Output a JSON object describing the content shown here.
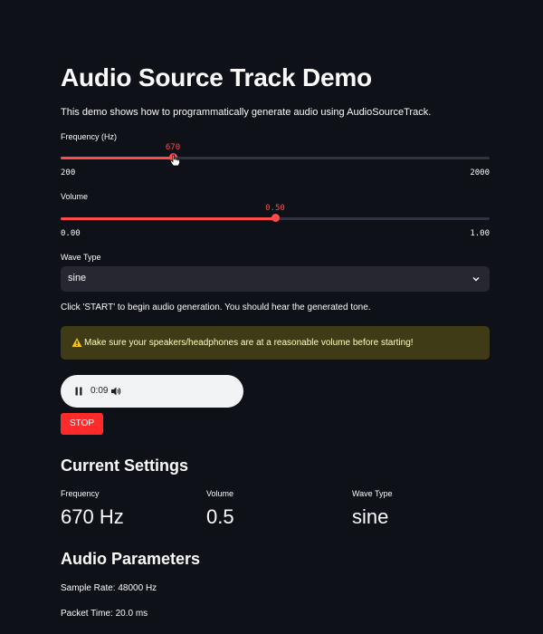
{
  "page": {
    "title": "Audio Source Track Demo",
    "description": "This demo shows how to programmatically generate audio using AudioSourceTrack."
  },
  "frequency_slider": {
    "label": "Frequency (Hz)",
    "value": "670",
    "min": "200",
    "max": "2000",
    "fraction": 0.261
  },
  "volume_slider": {
    "label": "Volume",
    "value": "0.50",
    "min": "0.00",
    "max": "1.00",
    "fraction": 0.5
  },
  "wave_select": {
    "label": "Wave Type",
    "value": "sine",
    "icon": "chevron-down-icon"
  },
  "instructions": "Click 'START' to begin audio generation. You should hear the generated tone.",
  "warning": {
    "icon": "warning-icon",
    "text": "Make sure your speakers/headphones are at a reasonable volume before starting!"
  },
  "player": {
    "time": "0:09",
    "pause_icon": "pause-icon",
    "volume_icon": "volume-icon"
  },
  "stop_button": {
    "label": "STOP"
  },
  "current_settings": {
    "heading": "Current Settings",
    "metrics": [
      {
        "label": "Frequency",
        "value": "670 Hz"
      },
      {
        "label": "Volume",
        "value": "0.5"
      },
      {
        "label": "Wave Type",
        "value": "sine"
      }
    ]
  },
  "audio_parameters": {
    "heading": "Audio Parameters",
    "items": [
      "Sample Rate: 48000 Hz",
      "Packet Time: 20.0 ms"
    ]
  },
  "colors": {
    "background": "#0e1117",
    "accent": "#ff4b4b",
    "button": "#ff2b2b",
    "warning_bg": "#3e3b16",
    "warning_text": "#ffffc2"
  }
}
